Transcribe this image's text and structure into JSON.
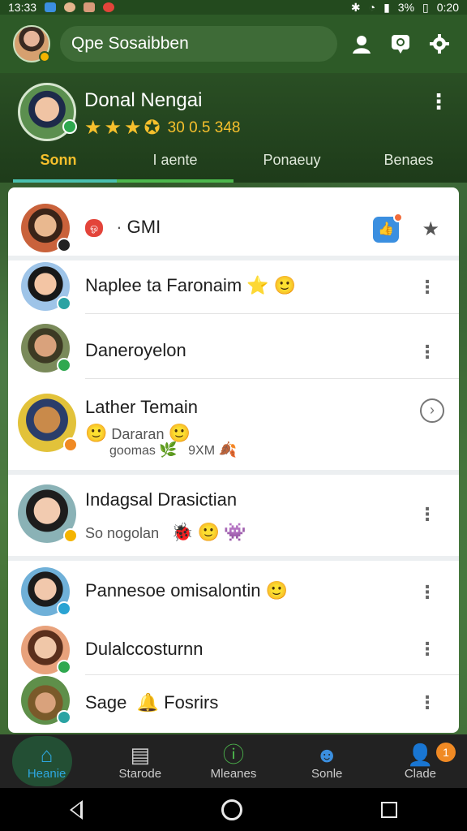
{
  "status_bar": {
    "time_left": "13:33",
    "battery": "3%",
    "time_right": "0:20"
  },
  "app_bar": {
    "search_text": "Qpe Sosaibben"
  },
  "profile": {
    "name": "Donal Nengai",
    "score": "30 0.5 348",
    "stars": 4
  },
  "tabs": [
    {
      "label": "Sonn",
      "active": true
    },
    {
      "label": "I aente"
    },
    {
      "label": "Ponaeuy"
    },
    {
      "label": "Benaes"
    }
  ],
  "list": {
    "pinned": {
      "label": "GMI",
      "pill": "ஓ"
    },
    "rows": [
      {
        "name": "Naplee ta Faronaim",
        "emoji": "⭐ 🙂"
      },
      {
        "name": "Daneroyelon"
      },
      {
        "name": "Lather Temain",
        "sub1": "Dararan",
        "sub2": "goomas",
        "sub3": "9XM"
      },
      {
        "name": "Indagsal Drasictian",
        "sub": "So nogolan"
      },
      {
        "name": "Pannesoe omisalontin",
        "emoji": "🙂"
      },
      {
        "name": "Dulalccosturnn"
      },
      {
        "name": "Sage",
        "extra": "Fosrirs"
      }
    ]
  },
  "bottom_nav": [
    {
      "label": "Heanie",
      "icon": "home-icon",
      "active": true
    },
    {
      "label": "Starode",
      "icon": "inbox-icon"
    },
    {
      "label": "Mleanes",
      "icon": "alert-icon"
    },
    {
      "label": "Sonle",
      "icon": "face-icon"
    },
    {
      "label": "Clade",
      "icon": "person-icon",
      "badge": "1"
    }
  ],
  "colors": {
    "accent_yellow": "#f6c02c",
    "app_green": "#2d5a27",
    "tab_underline": "#4ac0b0",
    "nav_active": "#2ea7e0"
  }
}
